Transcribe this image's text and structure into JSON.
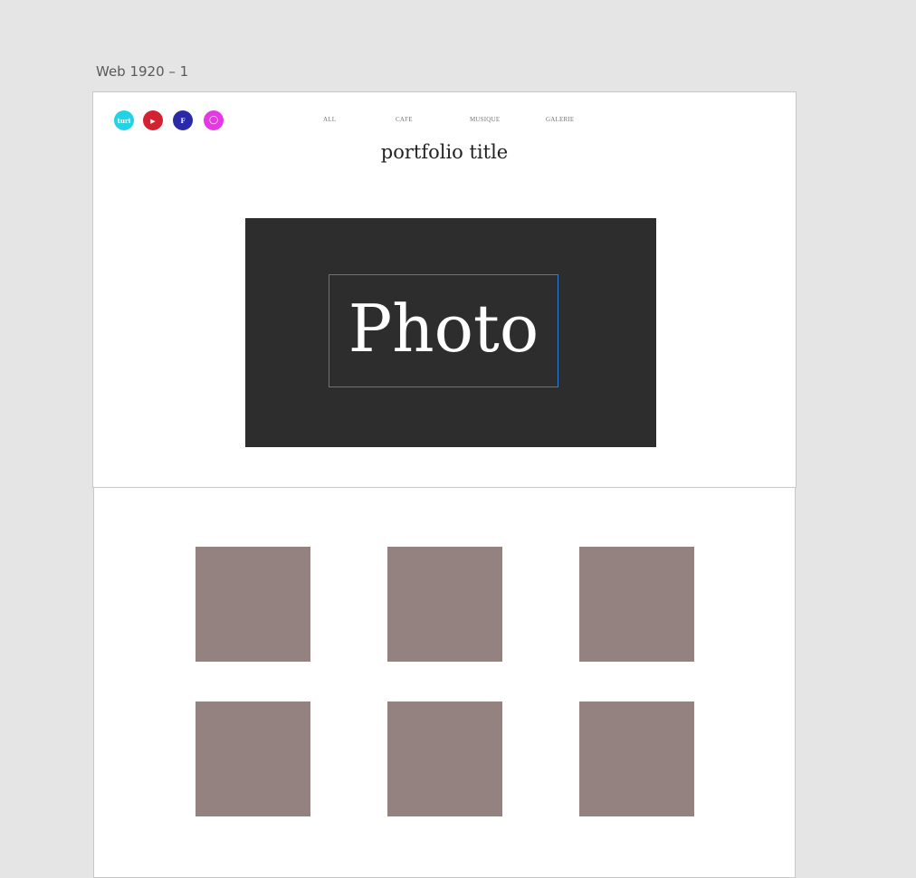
{
  "canvas": {
    "artboard_label": "Web 1920 – 1"
  },
  "header": {
    "social_icons": [
      {
        "name": "tumblr-icon",
        "label": "turi",
        "color": "#22d3e6"
      },
      {
        "name": "youtube-icon",
        "label": "▶",
        "color": "#d42030"
      },
      {
        "name": "facebook-icon",
        "label": "F",
        "color": "#2a2aa8"
      },
      {
        "name": "instagram-icon",
        "label": "◯",
        "color": "#e43ae4"
      }
    ],
    "nav": [
      "ALL",
      "CAFE",
      "MUSIQUE",
      "GALERIE"
    ],
    "title": "portfolio title"
  },
  "hero": {
    "text": "Photo",
    "background": "#2d2d2d",
    "selection_color": "#2f7fd6"
  },
  "gallery": {
    "thumb_color": "#948280"
  }
}
